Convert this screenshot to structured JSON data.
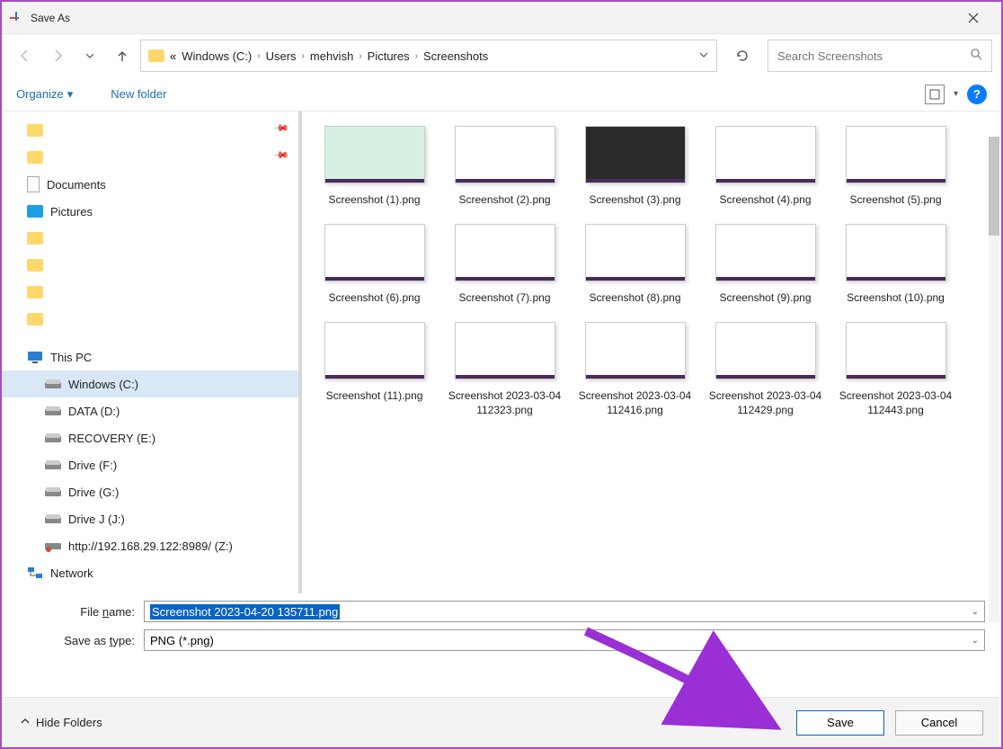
{
  "window": {
    "title": "Save As"
  },
  "breadcrumbs": {
    "prefix": "«",
    "items": [
      "Windows (C:)",
      "Users",
      "mehvish",
      "Pictures",
      "Screenshots"
    ]
  },
  "search": {
    "placeholder": "Search Screenshots"
  },
  "toolbar": {
    "organize": "Organize",
    "newfolder": "New folder"
  },
  "sidebar": {
    "quick": [
      {
        "label": "",
        "pinned": true
      },
      {
        "label": "",
        "pinned": true
      },
      {
        "label": "Documents",
        "icon": "doc",
        "pinned": false
      },
      {
        "label": "Pictures",
        "icon": "pics",
        "pinned": false
      },
      {
        "label": "",
        "icon": "folder"
      },
      {
        "label": "",
        "icon": "folder"
      },
      {
        "label": "",
        "icon": "folder"
      },
      {
        "label": "",
        "icon": "folder"
      }
    ],
    "pc": {
      "label": "This PC"
    },
    "drives": [
      {
        "label": "Windows (C:)",
        "selected": true
      },
      {
        "label": "DATA (D:)"
      },
      {
        "label": "RECOVERY (E:)"
      },
      {
        "label": "Drive (F:)"
      },
      {
        "label": "Drive (G:)"
      },
      {
        "label": "Drive J (J:)"
      },
      {
        "label": "http://192.168.29.122:8989/ (Z:)",
        "icon": "netdrive"
      }
    ],
    "network": {
      "label": "Network"
    }
  },
  "files": [
    {
      "label": "Screenshot (1).png"
    },
    {
      "label": "Screenshot (2).png"
    },
    {
      "label": "Screenshot (3).png"
    },
    {
      "label": "Screenshot (4).png"
    },
    {
      "label": "Screenshot (5).png"
    },
    {
      "label": "Screenshot (6).png"
    },
    {
      "label": "Screenshot (7).png"
    },
    {
      "label": "Screenshot (8).png"
    },
    {
      "label": "Screenshot (9).png"
    },
    {
      "label": "Screenshot (10).png"
    },
    {
      "label": "Screenshot (11).png"
    },
    {
      "label": "Screenshot 2023-03-04 112323.png"
    },
    {
      "label": "Screenshot 2023-03-04 112416.png"
    },
    {
      "label": "Screenshot 2023-03-04 112429.png"
    },
    {
      "label": "Screenshot 2023-03-04 112443.png"
    }
  ],
  "inputs": {
    "filename_label": "File name:",
    "filename_value": "Screenshot 2023-04-20 135711.png",
    "filetype_label": "Save as type:",
    "filetype_value": "PNG (*.png)"
  },
  "footer": {
    "hide": "Hide Folders",
    "save": "Save",
    "cancel": "Cancel"
  }
}
